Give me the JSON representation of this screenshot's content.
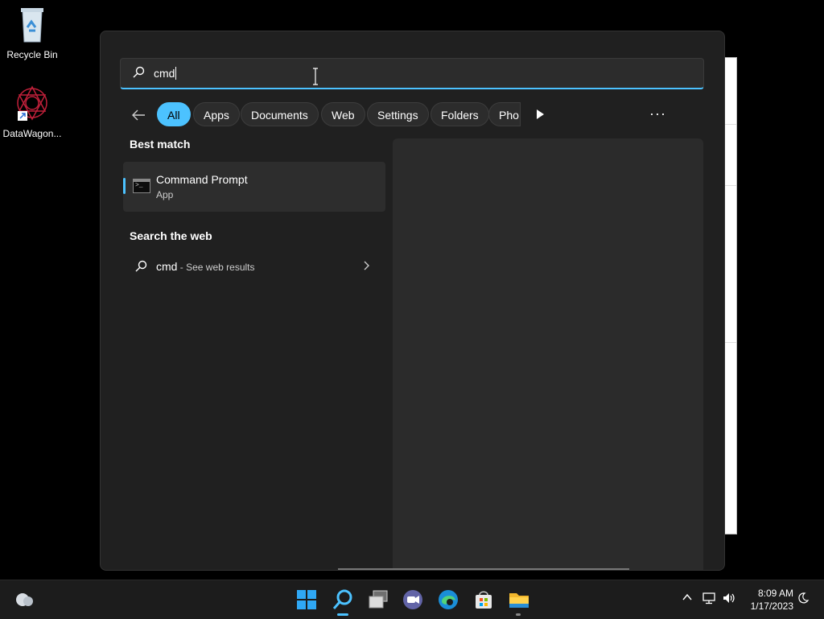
{
  "desktop": {
    "icons": [
      {
        "label": "Recycle Bin",
        "icon": "recycle-bin-icon"
      },
      {
        "label": "DataWagon...",
        "icon": "datawagon-icon"
      }
    ]
  },
  "search": {
    "query": "cmd",
    "filters": [
      {
        "label": "All",
        "active": true
      },
      {
        "label": "Apps"
      },
      {
        "label": "Documents"
      },
      {
        "label": "Web"
      },
      {
        "label": "Settings"
      },
      {
        "label": "Folders"
      },
      {
        "label": "Pho"
      }
    ],
    "more_label": "···",
    "best_match": {
      "heading": "Best match",
      "title": "Command Prompt",
      "subtitle": "App"
    },
    "web": {
      "heading": "Search the web",
      "query": "cmd",
      "suffix": " - See web results"
    }
  },
  "taskbar": {
    "time": "8:09 AM",
    "date": "1/17/2023",
    "accent": "#4cc2ff"
  }
}
